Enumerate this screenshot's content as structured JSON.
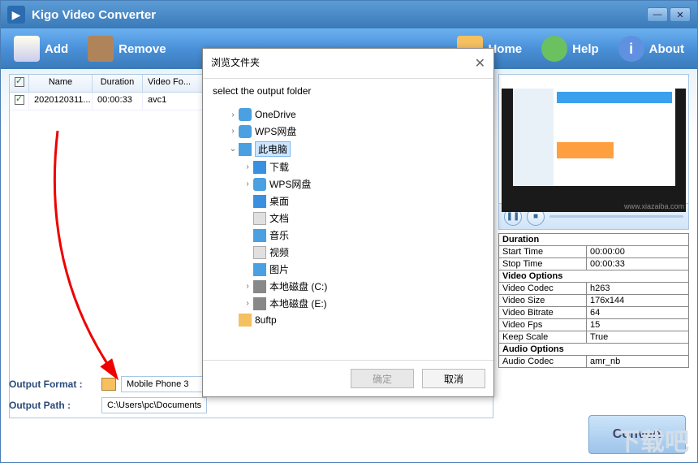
{
  "titlebar": {
    "title": "Kigo Video Converter"
  },
  "toolbar": {
    "add": "Add",
    "remove": "Remove",
    "home": "Home",
    "help": "Help",
    "about": "About"
  },
  "table": {
    "headers": {
      "name": "Name",
      "duration": "Duration",
      "videoFormat": "Video Fo..."
    },
    "rows": [
      {
        "name": "2020120311...",
        "duration": "00:00:33",
        "videoFormat": "avc1"
      }
    ]
  },
  "preview": {
    "watermark": "www.xiazaiba.com"
  },
  "options": {
    "durationHead": "Duration",
    "startTime": {
      "k": "Start Time",
      "v": "00:00:00"
    },
    "stopTime": {
      "k": "Stop Time",
      "v": "00:00:33"
    },
    "videoHead": "Video Options",
    "videoCodec": {
      "k": "Video Codec",
      "v": "h263"
    },
    "videoSize": {
      "k": "Video Size",
      "v": "176x144"
    },
    "videoBitrate": {
      "k": "Video Bitrate",
      "v": "64"
    },
    "videoFps": {
      "k": "Video Fps",
      "v": "15"
    },
    "keepScale": {
      "k": "Keep Scale",
      "v": "True"
    },
    "audioHead": "Audio Options",
    "audioCodec": {
      "k": "Audio Codec",
      "v": "amr_nb"
    }
  },
  "output": {
    "formatLabel": "Output Format :",
    "formatValue": "Mobile Phone 3",
    "pathLabel": "Output Path :",
    "pathValue": "C:\\Users\\pc\\Documents"
  },
  "convert": "Convert",
  "dialog": {
    "title": "浏览文件夹",
    "instruction": "select the output folder",
    "tree": [
      {
        "label": "OneDrive",
        "icon": "ic-cloud",
        "indent": 1,
        "toggle": ">"
      },
      {
        "label": "WPS网盘",
        "icon": "ic-cloud",
        "indent": 1,
        "toggle": ">"
      },
      {
        "label": "此电脑",
        "icon": "ic-pc",
        "indent": 1,
        "toggle": "v",
        "selected": true
      },
      {
        "label": "下载",
        "icon": "ic-down",
        "indent": 2,
        "toggle": ">"
      },
      {
        "label": "WPS网盘",
        "icon": "ic-cloud",
        "indent": 2,
        "toggle": ">"
      },
      {
        "label": "桌面",
        "icon": "ic-desk",
        "indent": 2,
        "toggle": ""
      },
      {
        "label": "文档",
        "icon": "ic-doc",
        "indent": 2,
        "toggle": ""
      },
      {
        "label": "音乐",
        "icon": "ic-music",
        "indent": 2,
        "toggle": ""
      },
      {
        "label": "视频",
        "icon": "ic-video",
        "indent": 2,
        "toggle": ""
      },
      {
        "label": "图片",
        "icon": "ic-pic",
        "indent": 2,
        "toggle": ""
      },
      {
        "label": "本地磁盘 (C:)",
        "icon": "ic-disk",
        "indent": 2,
        "toggle": ">"
      },
      {
        "label": "本地磁盘 (E:)",
        "icon": "ic-disk",
        "indent": 2,
        "toggle": ">"
      },
      {
        "label": "8uftp",
        "icon": "ic-folder",
        "indent": 1,
        "toggle": ""
      }
    ],
    "ok": "确定",
    "cancel": "取消"
  },
  "bgWatermark": "下载吧"
}
